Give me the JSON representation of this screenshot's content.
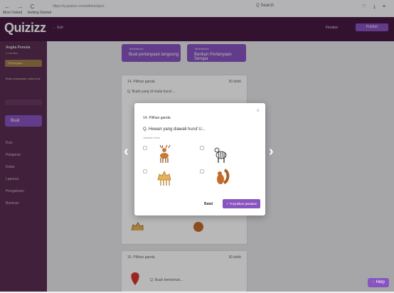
{
  "browser": {
    "nav": "← → C",
    "url": "https://q.quizizz.com/admin/quiz/...",
    "search_label": "Q Search",
    "icons_text": "♡ ⤓ ≡",
    "bookmarks": [
      "Most Visited",
      "Getting Started"
    ]
  },
  "header": {
    "logo": "Quizizz",
    "back_label": "← Exit",
    "right_label": "Finalize",
    "button_label": "Publish"
  },
  "sidebar": {
    "title": "Angka Pemula",
    "sub": "2 minutes",
    "box": "Pertanyaan",
    "text": "Buat pertanyaan untuk kuis",
    "create_label": "Buat",
    "links": [
      "Kuis",
      "Pelajaran",
      "Kelas",
      "Laporan",
      "Pengaturan",
      "Bantuan"
    ]
  },
  "top_buttons": [
    {
      "sub": "Tambahkan",
      "main": "Buat pertanyaan langsung"
    },
    {
      "sub": "Tambahkan",
      "main": "Berikan Pertanyaan Serupa"
    }
  ],
  "cards": [
    {
      "type": "14. Pilihan ganda",
      "time": "30 detik",
      "q": "Q. Buah yang di mulai huruf ..."
    },
    {
      "type": "15. Pilihan ganda",
      "time": "30 detik",
      "q": "Q. Buah berbentuk..."
    }
  ],
  "modal": {
    "type": "14. Pilihan ganda",
    "question": "Q. Hewan yang diawali huruf U...",
    "hint": "Jawaban benar",
    "cancel_label": "Batal",
    "show_label": "✓ Tunjukkan jawaban",
    "options": [
      {
        "icon": "deer-icon"
      },
      {
        "icon": "zebra-icon"
      },
      {
        "icon": "camel-icon"
      },
      {
        "icon": "squirrel-icon"
      }
    ]
  },
  "help_label": "Help",
  "colors": {
    "purple_dark": "#461a42",
    "purple_mid": "#5a2d52",
    "accent": "#8854c0"
  }
}
